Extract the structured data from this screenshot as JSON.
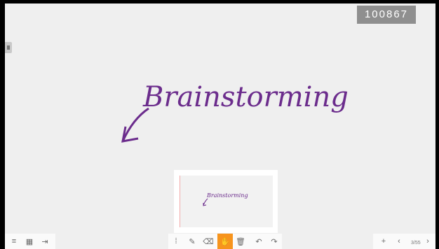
{
  "board": {
    "code": "100867",
    "text": "Brainstorming",
    "thumbnail_text": "Brainstorming"
  },
  "left_toolbar": {
    "menu_icon": "≡",
    "qr_icon": "▦",
    "exit_icon": "⇥"
  },
  "tools": {
    "select_icon": "⁞",
    "pen_icon": "✎",
    "eraser_icon": "⌫",
    "hand_icon": "✋",
    "delete_icon": "🗑",
    "undo_icon": "↶",
    "redo_icon": "↷"
  },
  "pagination": {
    "add_icon": "+",
    "prev_icon": "‹",
    "page": "3/55",
    "next_icon": "›"
  },
  "colors": {
    "ink": "#6b2c8c",
    "active_tool": "#f7941d",
    "board_bg": "#efefef"
  }
}
